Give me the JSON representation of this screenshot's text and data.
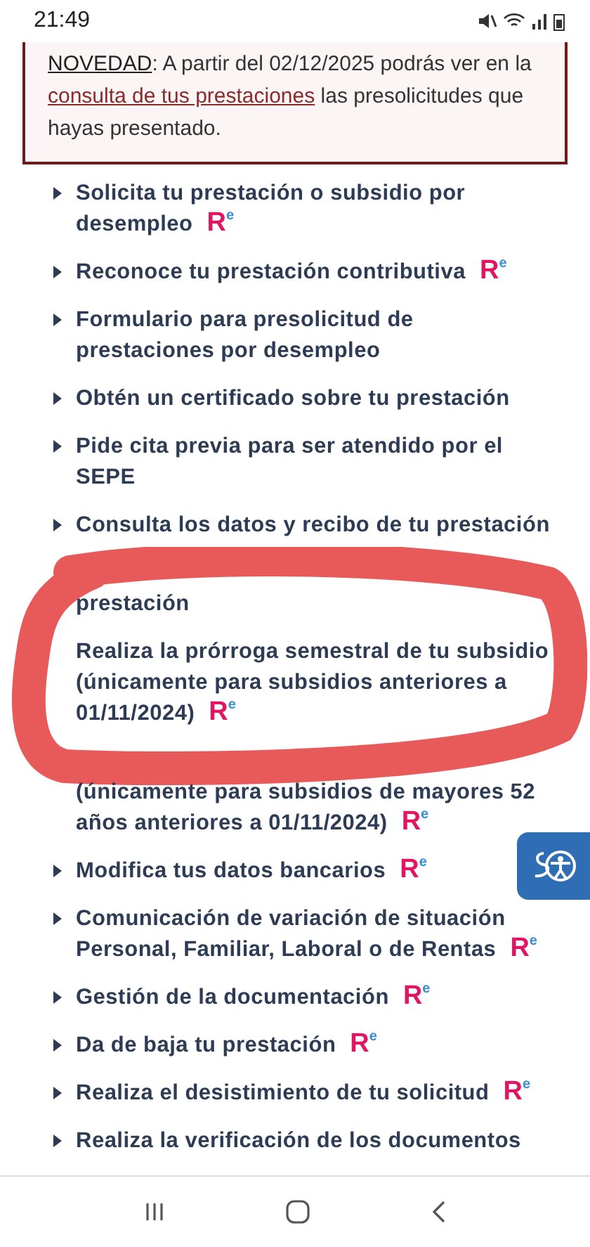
{
  "status_bar": {
    "time": "21:49"
  },
  "notice": {
    "label": "NOVEDAD",
    "text_before": ": A partir del 02/12/2025 podrás ver en la ",
    "link": "consulta de tus prestaciones",
    "text_after": " las presolicitudes que hayas presentado."
  },
  "services": [
    {
      "kind": "item",
      "text": "Solicita tu prestación o subsidio por desempleo",
      "bullet": true,
      "badge": {
        "main": "R",
        "sup": "e"
      }
    },
    {
      "kind": "item",
      "text": "Reconoce tu prestación contributiva",
      "bullet": true,
      "badge": {
        "main": "R",
        "sup": "e"
      }
    },
    {
      "kind": "item",
      "text": "Formulario para presolicitud de prestaciones por desempleo",
      "bullet": true
    },
    {
      "kind": "item",
      "text": "Obtén un certificado sobre tu prestación",
      "bullet": true
    },
    {
      "kind": "item",
      "text": "Pide cita previa para ser atendido por el SEPE",
      "bullet": true
    },
    {
      "kind": "item",
      "text": "Consulta los datos y recibo de tu prestación",
      "bullet": true
    },
    {
      "kind": "partial",
      "text": "prestación",
      "bullet": false
    },
    {
      "kind": "item",
      "text": "Realiza la prórroga semestral de tu subsidio (únicamente para subsidios anteriores a 01/11/2024)",
      "bullet": false,
      "badge": {
        "main": "R",
        "sup": "e"
      }
    },
    {
      "kind": "partial",
      "text": "(únicamente para subsidios de mayores 52 años anteriores a 01/11/2024)",
      "bullet": false,
      "badge": {
        "main": "R",
        "sup": "e"
      }
    },
    {
      "kind": "item",
      "text": "Modifica tus datos bancarios",
      "bullet": true,
      "badge": {
        "main": "R",
        "sup": "e"
      }
    },
    {
      "kind": "item",
      "text": "Comunicación de variación de situación Personal, Familiar, Laboral o de Rentas",
      "bullet": true,
      "badge": {
        "main": "R",
        "sup": "e"
      }
    },
    {
      "kind": "item",
      "text": "Gestión de la documentación",
      "bullet": true,
      "badge": {
        "main": "R",
        "sup": "e"
      }
    },
    {
      "kind": "item",
      "text": "Da de baja tu prestación",
      "bullet": true,
      "badge": {
        "main": "R",
        "sup": "e"
      }
    },
    {
      "kind": "item",
      "text": "Realiza el desistimiento de tu solicitud",
      "bullet": true,
      "badge": {
        "main": "R",
        "sup": "e"
      }
    },
    {
      "kind": "item",
      "text": "Realiza la verificación de los documentos",
      "bullet": true
    }
  ],
  "annotation": {
    "kind": "scribble"
  }
}
